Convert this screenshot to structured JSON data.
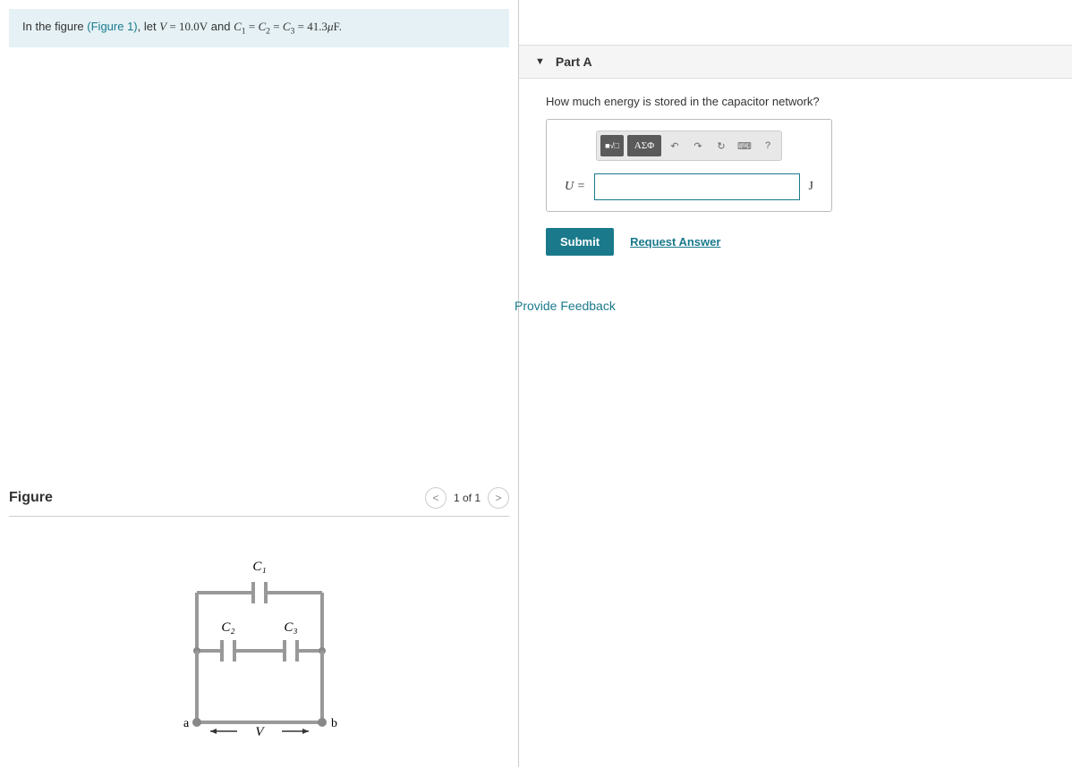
{
  "problem": {
    "prefix": "In the figure ",
    "figure_ref": "(Figure 1)",
    "middle": ", let ",
    "voltage_var": "V",
    "voltage_val": " = 10.0V",
    "and": " and ",
    "c1": "C",
    "c1_sub": "1",
    "eq1": " = ",
    "c2": "C",
    "c2_sub": "2",
    "eq2": " = ",
    "c3": "C",
    "c3_sub": "3",
    "eq3": " = 41.3",
    "mu": "μ",
    "unit_end": "F."
  },
  "figure": {
    "title": "Figure",
    "nav": "1 of 1",
    "labels": {
      "c1": "C₁",
      "c2": "C₂",
      "c3": "C₃",
      "a": "a",
      "b": "b",
      "v": "V"
    }
  },
  "part": {
    "title": "Part A",
    "question": "How much energy is stored in the capacitor network?",
    "var_label": "U =",
    "unit": "J",
    "toolbar": {
      "templates": "■√□",
      "greek": "ΑΣΦ",
      "undo": "↶",
      "redo": "↷",
      "reset": "↻",
      "keyboard": "⌨",
      "help": "?"
    },
    "submit": "Submit",
    "request": "Request Answer"
  },
  "feedback": "Provide Feedback"
}
